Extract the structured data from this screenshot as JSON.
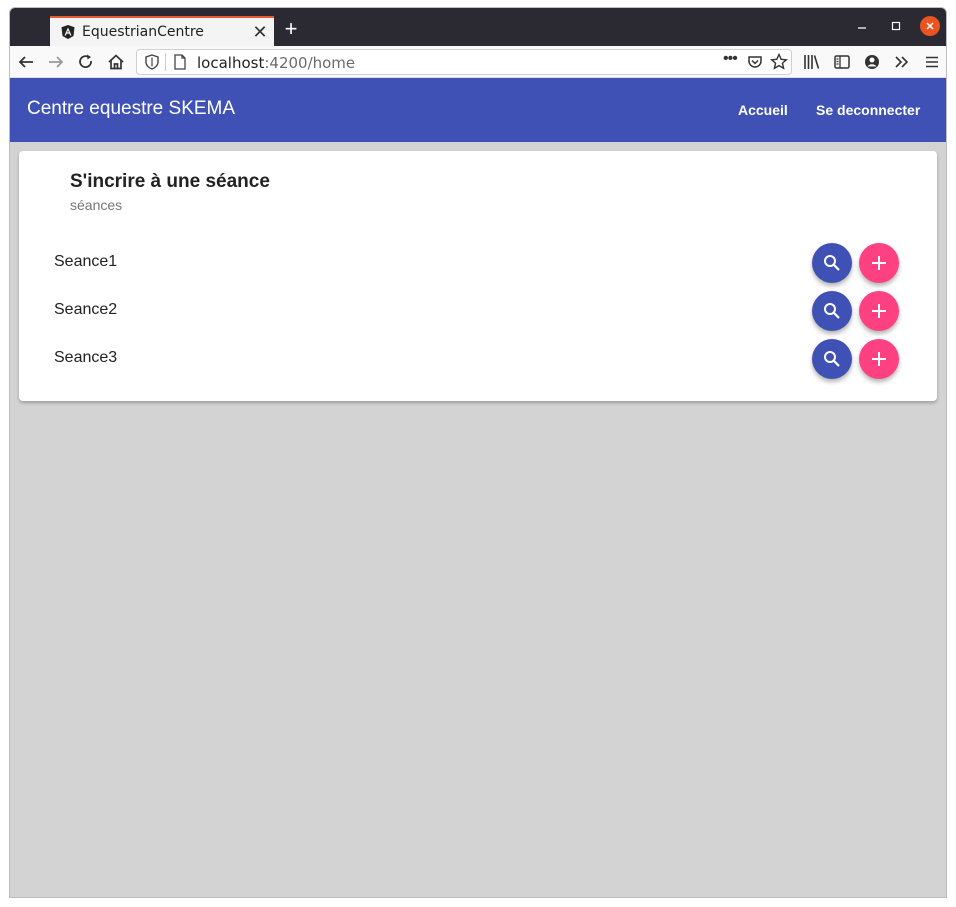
{
  "browser": {
    "tab_title": "EquestrianCentre",
    "url_host": "localhost",
    "url_rest": ":4200/home",
    "icons": [
      "back-icon",
      "forward-icon",
      "reload-icon",
      "home-icon",
      "shield-icon",
      "page-icon",
      "more-icon",
      "pocket-icon",
      "star-icon",
      "library-icon",
      "sidebar-icon",
      "account-icon",
      "overflow-icon",
      "menu-icon"
    ]
  },
  "toolbar": {
    "title": "Centre equestre SKEMA",
    "accueil": "Accueil",
    "logout": "Se deconnecter",
    "color": "#3f51b5"
  },
  "card": {
    "title": "S'incrire à une séance",
    "subtitle": "séances",
    "items": [
      {
        "label": "Seance1"
      },
      {
        "label": "Seance2"
      },
      {
        "label": "Seance3"
      }
    ]
  },
  "colors": {
    "primary": "#3f51b5",
    "accent": "#ff4081",
    "background": "#d3d3d3"
  }
}
